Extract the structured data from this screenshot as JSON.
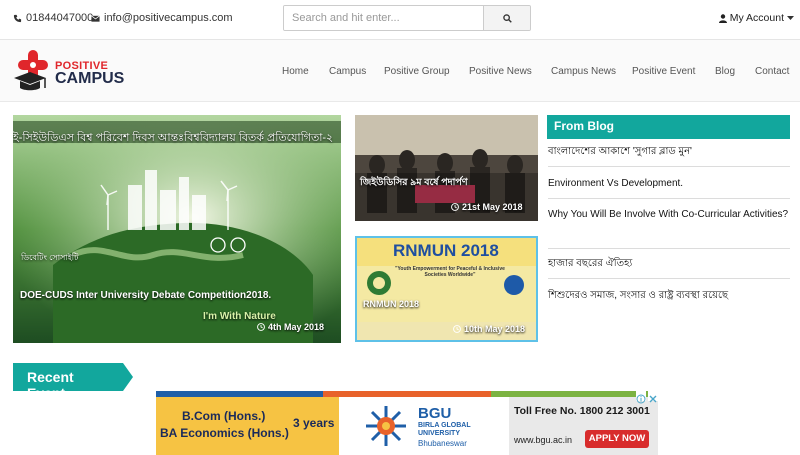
{
  "topbar": {
    "phone": "01844047000",
    "email": "info@positivecampus.com",
    "search_placeholder": "Search and hit enter...",
    "account_label": "My Account"
  },
  "brand": {
    "line1": "POSITIVE",
    "line2": "CAMPUS"
  },
  "nav": {
    "items": [
      "Home",
      "Campus",
      "Positive Group",
      "Positive News",
      "Campus News",
      "Positive Event",
      "Blog",
      "Contact"
    ]
  },
  "featured": {
    "banner_text": "ই-সিইউডিএস বিশ্ব পরিবেশ দিবস আন্তঃবিশ্ববিদ্যালয় বিতর্ক প্রতিযোগিতা-২",
    "society_text": "ডিবেটিং সোসাইটি",
    "slogan": "I'm With Nature",
    "title": "DOE-CUDS Inter University Debate Competition2018.",
    "date": "4th May 2018"
  },
  "cards": [
    {
      "title": "জিইউডিসির ৯ম বর্ষে পদার্পণ",
      "date": "21st May 2018"
    },
    {
      "poster_title": "RNMUN 2018",
      "poster_sub": "\"Youth Empowerment for Peaceful & Inclusive Societies Worldwide\"",
      "title": "RNMUN 2018",
      "date": "10th May 2018"
    }
  ],
  "blog": {
    "heading": "From Blog",
    "items": [
      "বাংলাদেশের আকাশে 'সুগার ব্লাড মুন'",
      "Environment Vs Development.",
      "Why You Will Be Involve With Co-Curricular Activities?",
      "হাজার বছরের ঐতিহ্য",
      "শিশুদেরও সমাজ, সংসার ও রাষ্ট্র ব্যবস্থা রয়েছে"
    ]
  },
  "recent_event": {
    "label": "Recent Event"
  },
  "ad": {
    "course1": "B.Com (Hons.)",
    "course2": "BA Economics (Hons.)",
    "duration": "3 years",
    "uni_short": "BGU",
    "uni_line1": "BIRLA GLOBAL",
    "uni_line2": "UNIVERSITY",
    "uni_city": "Bhubaneswar",
    "tollfree": "Toll Free No. 1800 212 3001",
    "website": "www.bgu.ac.in",
    "cta": "APPLY NOW"
  },
  "colors": {
    "accent": "#12a79d",
    "brand_red": "#e0262b",
    "brand_navy": "#222c4a",
    "ad_yellow": "#f6c343"
  },
  "icons": [
    "phone-icon",
    "envelope-icon",
    "search-icon",
    "user-icon",
    "caret-down-icon",
    "clock-icon",
    "ad-info-icon",
    "ad-close-icon"
  ]
}
